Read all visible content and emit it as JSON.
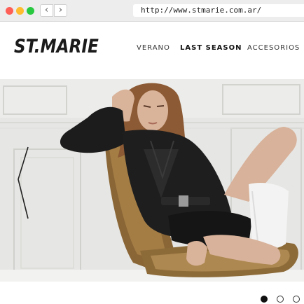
{
  "browser": {
    "back_glyph": "‹",
    "forward_glyph": "›",
    "url": "http://www.stmarie.com.ar/"
  },
  "site": {
    "logo": "ST.MARIE",
    "nav": [
      "VERANO",
      "LAST SEASON",
      "ACCESORIOS"
    ]
  },
  "hero": {
    "icons": [
      "chevron-left-icon"
    ]
  },
  "slider": {
    "active_index": 0,
    "count": 3
  }
}
